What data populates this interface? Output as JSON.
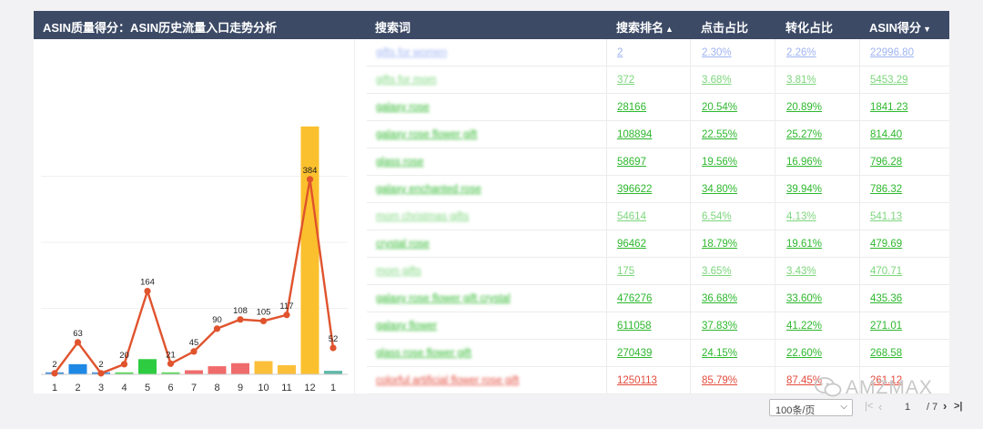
{
  "header": {
    "title": "ASIN质量得分：ASIN历史流量入口走势分析",
    "columns": [
      {
        "label": "搜索词",
        "sort": ""
      },
      {
        "label": "搜索排名",
        "sort": "▲"
      },
      {
        "label": "点击占比",
        "sort": ""
      },
      {
        "label": "转化占比",
        "sort": ""
      },
      {
        "label": "ASIN得分",
        "sort": "▼"
      }
    ]
  },
  "colors": {
    "header_bg": "#3c4a66",
    "line": "#e0532d",
    "pale_blue": "#9fb4f2",
    "light_green": "#7dd67d",
    "green": "#2db82d",
    "red": "#e44b3c"
  },
  "chart_data": {
    "type": "bar",
    "categories": [
      "1",
      "2",
      "3",
      "4",
      "5",
      "6",
      "7",
      "8",
      "9",
      "10",
      "11",
      "12",
      "1"
    ],
    "series": [
      {
        "type": "line",
        "values": [
          2,
          63,
          2,
          20,
          164,
          21,
          45,
          90,
          108,
          105,
          117,
          384,
          52
        ]
      },
      {
        "type": "bar",
        "values": [
          4,
          20,
          4,
          4,
          30,
          4,
          8,
          16,
          22,
          26,
          18,
          488,
          7
        ],
        "colors": [
          "#4a90d9",
          "#1e88e5",
          "#4a90d9",
          "#5cd65c",
          "#2ecc40",
          "#5cd65c",
          "#f06b6b",
          "#f06b6b",
          "#f06b6b",
          "#fbbf3a",
          "#fbbf3a",
          "#fbc02d",
          "#5fb8a8"
        ]
      }
    ],
    "ylim": [
      0,
      520
    ]
  },
  "table": {
    "rows": [
      {
        "keyword": "gifts for women",
        "rank": "2",
        "click": "2.30%",
        "conv": "2.26%",
        "score": "22996.80",
        "color": "#9fb4f2"
      },
      {
        "keyword": "gifts for mom",
        "rank": "372",
        "click": "3.68%",
        "conv": "3.81%",
        "score": "5453.29",
        "color": "#7dd67d"
      },
      {
        "keyword": "galaxy rose",
        "rank": "28166",
        "click": "20.54%",
        "conv": "20.89%",
        "score": "1841.23",
        "color": "#2db82d"
      },
      {
        "keyword": "galaxy rose flower gift",
        "rank": "108894",
        "click": "22.55%",
        "conv": "25.27%",
        "score": "814.40",
        "color": "#2db82d"
      },
      {
        "keyword": "glass rose",
        "rank": "58697",
        "click": "19.56%",
        "conv": "16.96%",
        "score": "796.28",
        "color": "#2db82d"
      },
      {
        "keyword": "galaxy enchanted rose",
        "rank": "396622",
        "click": "34.80%",
        "conv": "39.94%",
        "score": "786.32",
        "color": "#2db82d"
      },
      {
        "keyword": "mom christmas gifts",
        "rank": "54614",
        "click": "6.54%",
        "conv": "4.13%",
        "score": "541.13",
        "color": "#7dd67d"
      },
      {
        "keyword": "crystal rose",
        "rank": "96462",
        "click": "18.79%",
        "conv": "19.61%",
        "score": "479.69",
        "color": "#2db82d"
      },
      {
        "keyword": "mom gifts",
        "rank": "175",
        "click": "3.65%",
        "conv": "3.43%",
        "score": "470.71",
        "color": "#7dd67d"
      },
      {
        "keyword": "galaxy rose flower gift crystal",
        "rank": "476276",
        "click": "36.68%",
        "conv": "33.60%",
        "score": "435.36",
        "color": "#2db82d"
      },
      {
        "keyword": "galaxy flower",
        "rank": "611058",
        "click": "37.83%",
        "conv": "41.22%",
        "score": "271.01",
        "color": "#2db82d"
      },
      {
        "keyword": "glass rose flower gift",
        "rank": "270439",
        "click": "24.15%",
        "conv": "22.60%",
        "score": "268.58",
        "color": "#2db82d"
      },
      {
        "keyword": "colorful artificial flower rose gift",
        "rank": "1250113",
        "click": "85.79%",
        "conv": "87.45%",
        "score": "261.12",
        "color": "#e44b3c"
      }
    ]
  },
  "pager": {
    "page_size": "100条/页",
    "current_page": "1",
    "total": "/ 7"
  },
  "watermark": "AMZMAX"
}
